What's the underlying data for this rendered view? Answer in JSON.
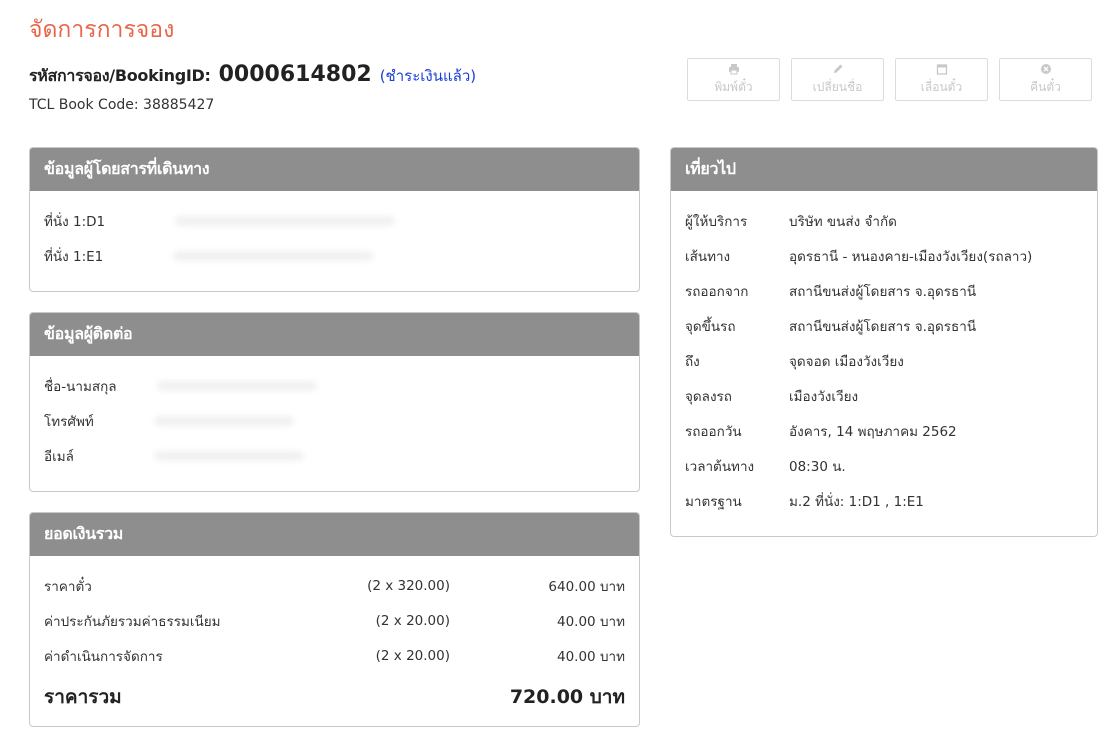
{
  "page": {
    "title": "จัดการการจอง"
  },
  "booking": {
    "label": "รหัสการจอง/BookingID:",
    "id": "0000614802",
    "status": "(ชำระเงินแล้ว)",
    "tcl_code": "TCL Book Code: 38885427"
  },
  "actions": [
    {
      "label": "พิมพ์ตั๋ว",
      "icon": "printer-icon"
    },
    {
      "label": "เปลี่ยนชื่อ",
      "icon": "pencil-icon"
    },
    {
      "label": "เลื่อนตั๋ว",
      "icon": "calendar-icon"
    },
    {
      "label": "คืนตั๋ว",
      "icon": "cancel-icon"
    }
  ],
  "passengers": {
    "title": "ข้อมูลผู้โดยสารที่เดินทาง",
    "seats": [
      "ที่นั่ง 1:D1",
      "ที่นั่ง 1:E1"
    ]
  },
  "contact": {
    "title": "ข้อมูลผู้ติดต่อ",
    "fields": [
      "ชื่อ-นามสกุล",
      "โทรศัพท์",
      "อีเมล์"
    ]
  },
  "totals": {
    "title": "ยอดเงินรวม",
    "rows": [
      {
        "desc": "ราคาตั๋ว",
        "qty": "(2 x 320.00)",
        "amount": "640.00 บาท"
      },
      {
        "desc": "ค่าประกันภัยรวมค่าธรรมเนียม",
        "qty": "(2 x 20.00)",
        "amount": "40.00 บาท"
      },
      {
        "desc": "ค่าดำเนินการจัดการ",
        "qty": "(2 x 20.00)",
        "amount": "40.00 บาท"
      }
    ],
    "total_label": "ราคารวม",
    "total_value": "720.00 บาท"
  },
  "trip": {
    "title": "เที่ยวไป",
    "rows": [
      {
        "label": "ผู้ให้บริการ",
        "value": "บริษัท ขนส่ง จำกัด"
      },
      {
        "label": "เส้นทาง",
        "value": "อุดรธานี - หนองคาย-เมืองวังเวียง(รถลาว)"
      },
      {
        "label": "รถออกจาก",
        "value": "สถานีขนส่งผู้โดยสาร จ.อุดรธานี"
      },
      {
        "label": "จุดขึ้นรถ",
        "value": "สถานีขนส่งผู้โดยสาร จ.อุดรธานี"
      },
      {
        "label": "ถึง",
        "value": "จุดจอด เมืองวังเวียง"
      },
      {
        "label": "จุดลงรถ",
        "value": "เมืองวังเวียง"
      },
      {
        "label": "รถออกวัน",
        "value": "อังคาร, 14 พฤษภาคม 2562"
      },
      {
        "label": "เวลาต้นทาง",
        "value": "08:30 น."
      },
      {
        "label": "มาตรฐาน",
        "value": "ม.2 ที่นั่ง: 1:D1 , 1:E1"
      }
    ]
  }
}
